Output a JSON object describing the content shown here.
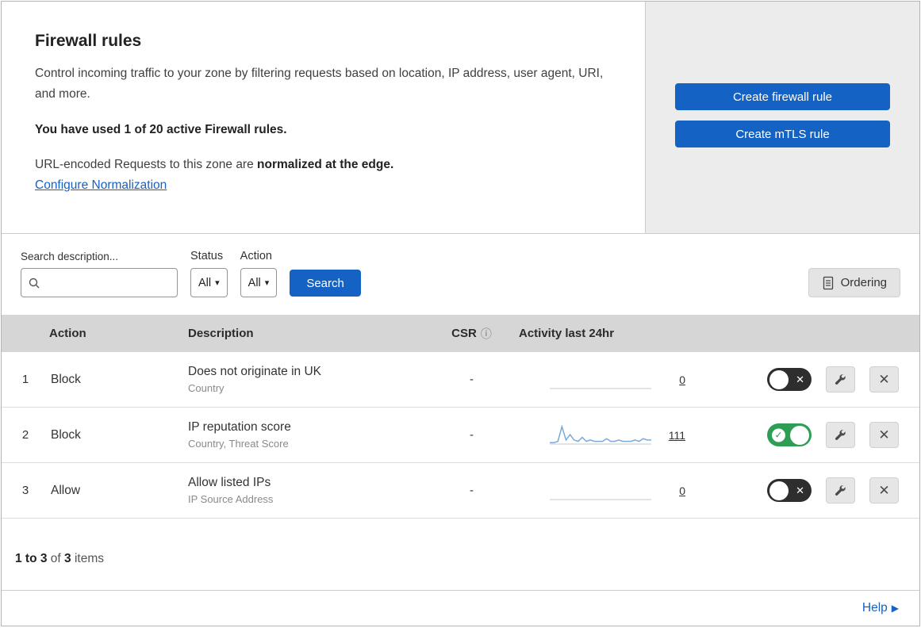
{
  "header": {
    "title": "Firewall rules",
    "description": "Control incoming traffic to your zone by filtering requests based on location, IP address, user agent, URI, and more.",
    "usage_line": "You have used 1 of 20 active Firewall rules.",
    "normalization_prefix": "URL-encoded Requests to this zone are ",
    "normalization_bold": "normalized at the edge.",
    "normalization_link": "Configure Normalization",
    "create_firewall_button": "Create firewall rule",
    "create_mtls_button": "Create mTLS rule"
  },
  "toolbar": {
    "search_label": "Search description...",
    "search_value": "",
    "status_label": "Status",
    "status_value": "All",
    "action_label": "Action",
    "action_value": "All",
    "search_button": "Search",
    "ordering_button": "Ordering"
  },
  "table": {
    "columns": {
      "action": "Action",
      "description": "Description",
      "csr": "CSR",
      "activity": "Activity last 24hr"
    },
    "rows": [
      {
        "index": "1",
        "action": "Block",
        "description": "Does not originate in UK",
        "subtitle": "Country",
        "csr": "-",
        "count": "0",
        "enabled": false,
        "sparkline": []
      },
      {
        "index": "2",
        "action": "Block",
        "description": "IP reputation score",
        "subtitle": "Country, Threat Score",
        "csr": "-",
        "count": "111",
        "enabled": true,
        "sparkline": [
          1,
          1,
          2,
          13,
          3,
          7,
          3,
          2,
          5,
          2,
          3,
          2,
          2,
          2,
          4,
          2,
          2,
          3,
          2,
          2,
          2,
          3,
          2,
          4,
          3,
          3
        ]
      },
      {
        "index": "3",
        "action": "Allow",
        "description": "Allow listed IPs",
        "subtitle": "IP Source Address",
        "csr": "-",
        "count": "0",
        "enabled": false,
        "sparkline": []
      }
    ]
  },
  "footer": {
    "range": "1 to 3",
    "of_text": " of ",
    "total": "3",
    "items_text": " items"
  },
  "help": {
    "label": "Help"
  },
  "icons": {
    "check": "✓",
    "cross": "✕",
    "caret": "▾",
    "info": "ⓘ",
    "help_arrow": "▶"
  },
  "colors": {
    "accent_blue": "#1562c5",
    "toggle_on_green": "#2e9e55",
    "sparkline_blue": "#7aa9d8",
    "table_header_gray": "#d6d6d6",
    "panel_gray": "#ececec"
  }
}
